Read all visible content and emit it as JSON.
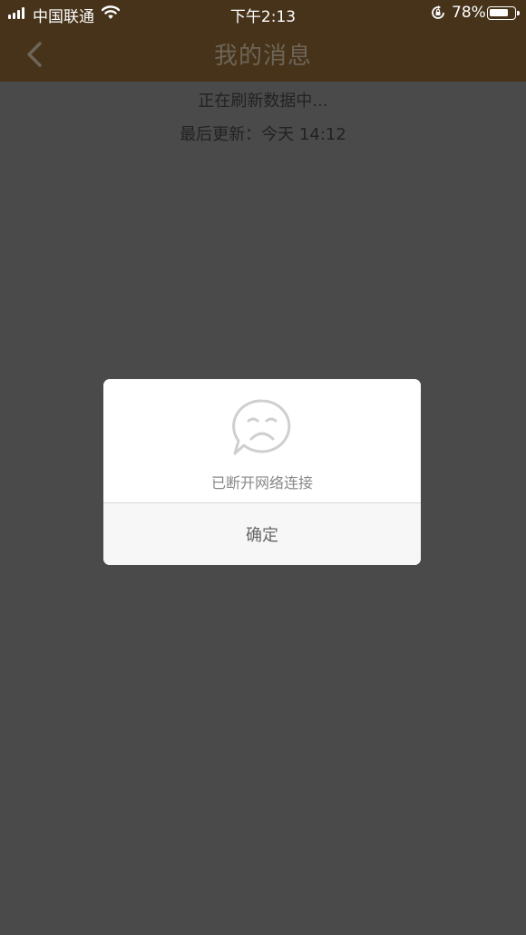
{
  "status_bar": {
    "carrier": "中国联通",
    "time": "下午2:13",
    "battery_percent": "78%",
    "battery_level": 0.78,
    "icons": [
      "signal-icon",
      "wifi-icon",
      "orientation-lock-icon",
      "battery-icon"
    ]
  },
  "nav": {
    "back_icon": "chevron-left-icon",
    "title": "我的消息"
  },
  "refresh": {
    "status": "正在刷新数据中...",
    "last_updated": "最后更新：今天 14:12"
  },
  "dialog": {
    "icon": "sad-face-speech-bubble-icon",
    "message": "已断开网络连接",
    "confirm_label": "确定"
  },
  "colors": {
    "nav_background_dimmed": "#46331a",
    "overlay_background": "#4a4a4a",
    "dialog_background": "#ffffff",
    "dialog_button_background": "#f7f7f7"
  }
}
